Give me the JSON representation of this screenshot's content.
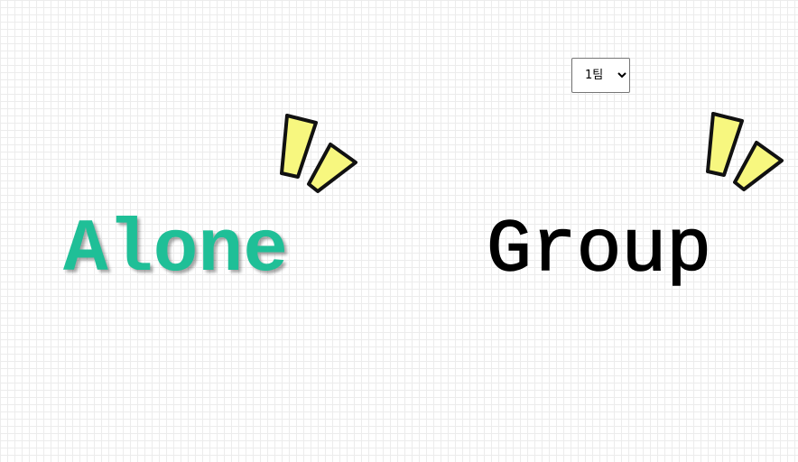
{
  "team_select": {
    "selected": "1팀",
    "options": [
      "1팀"
    ]
  },
  "modes": {
    "alone_label": "Alone",
    "group_label": "Group"
  },
  "colors": {
    "alone": "#1fbf97",
    "group": "#000000",
    "spark_fill": "#f7f77f",
    "spark_outline": "#111111",
    "grid": "#ececec"
  },
  "icons": {
    "alone_decoration": "sparkle-icon",
    "group_decoration": "sparkle-icon"
  }
}
